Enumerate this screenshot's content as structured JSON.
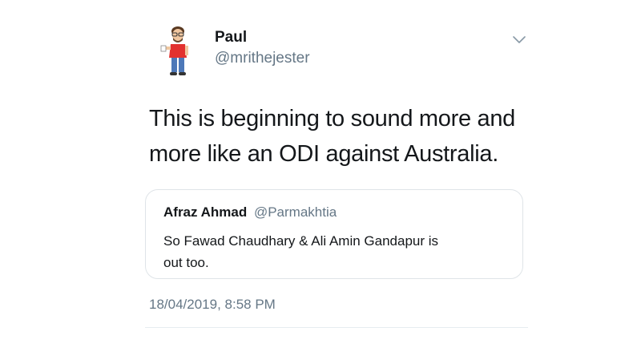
{
  "user": {
    "name": "Paul",
    "handle": "@mrithejester",
    "avatar_icon": "bitmoji-avatar-icon"
  },
  "tweet": {
    "line1": "This is beginning to sound more and",
    "line2": "more like an ODI against Australia.",
    "timestamp": "18/04/2019, 8:58 PM"
  },
  "quoted_tweet": {
    "name": "Afraz Ahmad",
    "handle": "@Parmakhtia",
    "line1": "So Fawad Chaudhary & Ali Amin Gandapur is",
    "line2": "out too."
  },
  "icons": {
    "more": "chevron-down-icon"
  },
  "colors": {
    "text_primary": "#14171a",
    "text_secondary": "#657786",
    "border": "#dfe4e8"
  }
}
